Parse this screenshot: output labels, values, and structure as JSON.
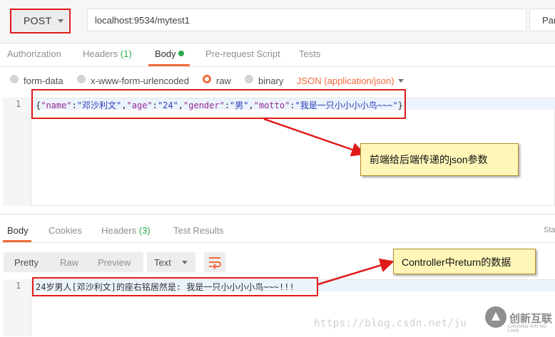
{
  "request": {
    "method": "POST",
    "url": "localhost:9534/mytest1",
    "params_label": "Par"
  },
  "request_tabs": [
    {
      "label": "Authorization"
    },
    {
      "label": "Headers",
      "count": "(1)"
    },
    {
      "label": "Body"
    },
    {
      "label": "Pre-request Script"
    },
    {
      "label": "Tests"
    }
  ],
  "body_types": {
    "form_data": "form-data",
    "urlencoded": "x-www-form-urlencoded",
    "raw": "raw",
    "binary": "binary",
    "content_type": "JSON (application/json)"
  },
  "request_body": {
    "line_number": "1",
    "pairs": [
      {
        "key": "\"name\"",
        "value": "\"邓沙利文\""
      },
      {
        "key": "\"age\"",
        "value": "\"24\""
      },
      {
        "key": "\"gender\"",
        "value": "\"男\""
      },
      {
        "key": "\"motto\"",
        "value": "\"我是一只小小小小鸟~~~\""
      }
    ]
  },
  "response_tabs": [
    {
      "label": "Body"
    },
    {
      "label": "Cookies"
    },
    {
      "label": "Headers",
      "count": "(3)"
    },
    {
      "label": "Test Results"
    }
  ],
  "response_status_label": "Sta",
  "response_toolbar": {
    "pretty": "Pretty",
    "raw": "Raw",
    "preview": "Preview",
    "format": "Text"
  },
  "response_body": {
    "line_number": "1",
    "text": "24岁男人[邓沙利文]的座右铭居然是: 我是一只小小小小鸟~~~!!!"
  },
  "annotations": {
    "request_note": "前端给后端传递的json参数",
    "response_note": "Controller中return的数据"
  },
  "watermark": {
    "url": "https://blog.csdn.net/ju",
    "logo_text": "创新互联",
    "logo_sub": "CHUANG XIN HU LIAN"
  },
  "colors": {
    "accent": "#f26b3a",
    "tab_count_green": "#2aaa4d",
    "annotation_red": "#e01a1a",
    "callout_yellow": "#fff6b8"
  },
  "icons": {
    "method_dropdown": "chevron-down-icon",
    "content_type_dropdown": "chevron-down-icon",
    "format_dropdown": "chevron-down-icon",
    "wrap_lines": "wrap-lines-icon",
    "body_active_dot": "status-dot-icon",
    "logo": "chuangxin-logo-icon"
  }
}
